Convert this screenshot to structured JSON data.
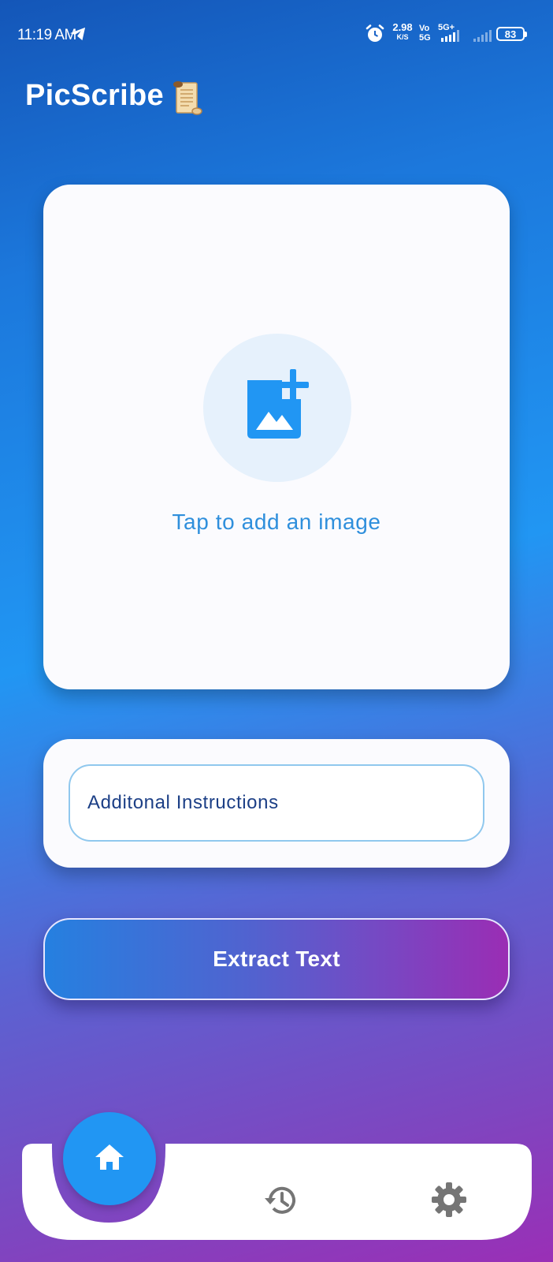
{
  "status_bar": {
    "time": "11:19 AM",
    "net_speed_value": "2.98",
    "net_speed_unit": "K/S",
    "volte_line1": "Vo",
    "volte_line2": "5G",
    "network_type": "5G+",
    "battery_level": "83"
  },
  "header": {
    "app_title": "PicScribe",
    "title_icon": "scroll-icon"
  },
  "image_picker": {
    "icon": "add-photo-icon",
    "label": "Tap to add an image"
  },
  "instructions": {
    "placeholder": "Additonal Instructions"
  },
  "extract_button": {
    "label": "Extract Text"
  },
  "bottom_nav": {
    "items": [
      {
        "icon": "home-icon",
        "active": true
      },
      {
        "icon": "history-icon",
        "active": false
      },
      {
        "icon": "settings-icon",
        "active": false
      }
    ]
  },
  "colors": {
    "accent": "#2196f3",
    "label_blue": "#2f8fdc",
    "input_text": "#1c3f86",
    "gradient_purple": "#9a2db4",
    "icon_gray": "#757575"
  }
}
